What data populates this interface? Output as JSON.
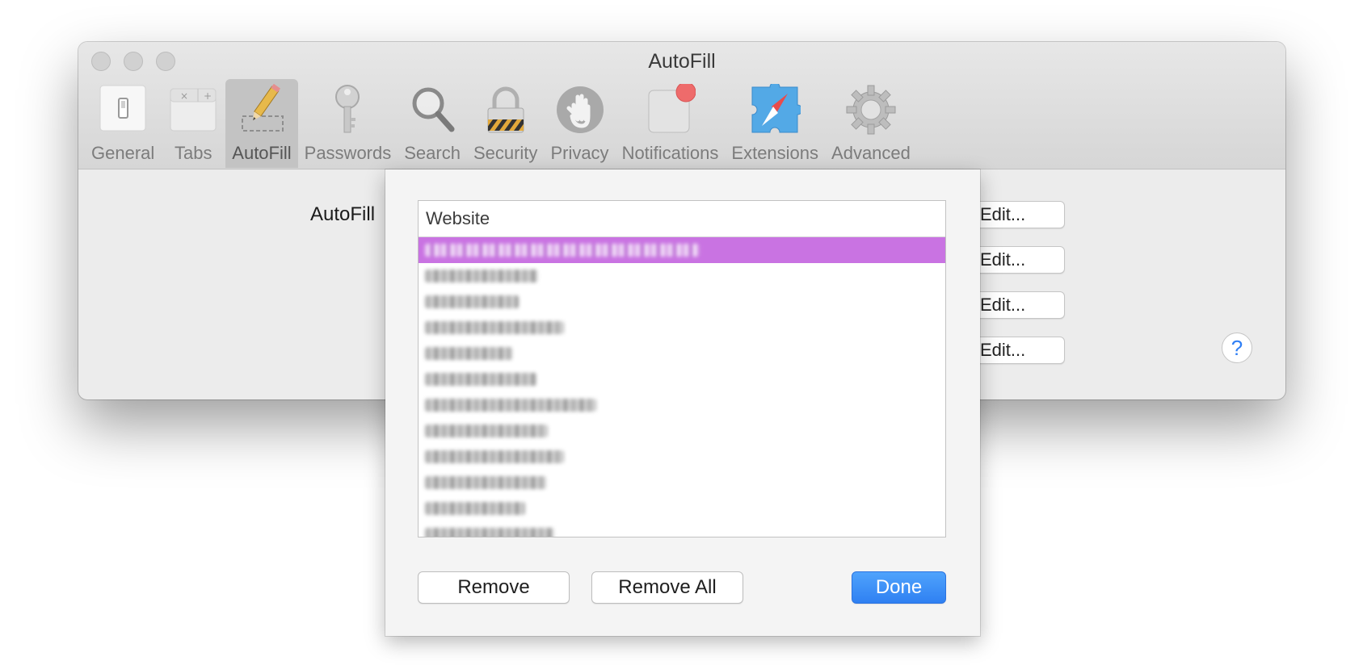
{
  "window": {
    "title": "AutoFill"
  },
  "toolbar": {
    "items": [
      {
        "label": "General",
        "icon": "general-switch-icon"
      },
      {
        "label": "Tabs",
        "icon": "tabs-icon"
      },
      {
        "label": "AutoFill",
        "icon": "autofill-pencil-icon",
        "selected": true
      },
      {
        "label": "Passwords",
        "icon": "key-icon"
      },
      {
        "label": "Search",
        "icon": "magnifier-icon"
      },
      {
        "label": "Security",
        "icon": "padlock-icon"
      },
      {
        "label": "Privacy",
        "icon": "hand-icon"
      },
      {
        "label": "Notifications",
        "icon": "notification-badge-icon"
      },
      {
        "label": "Extensions",
        "icon": "puzzle-compass-icon"
      },
      {
        "label": "Advanced",
        "icon": "gear-icon"
      }
    ]
  },
  "main": {
    "autofill_label": "AutoFill",
    "edit_buttons": [
      "Edit...",
      "Edit...",
      "Edit...",
      "Edit..."
    ],
    "help_label": "?"
  },
  "sheet": {
    "column_header": "Website",
    "rows_blurred": true,
    "buttons": {
      "remove": "Remove",
      "remove_all": "Remove All",
      "done": "Done"
    }
  },
  "colors": {
    "selection": "#c973e2",
    "accent": "#2f80f2",
    "help": "#2f7ff5",
    "notification_badge": "#ee6b6b"
  }
}
